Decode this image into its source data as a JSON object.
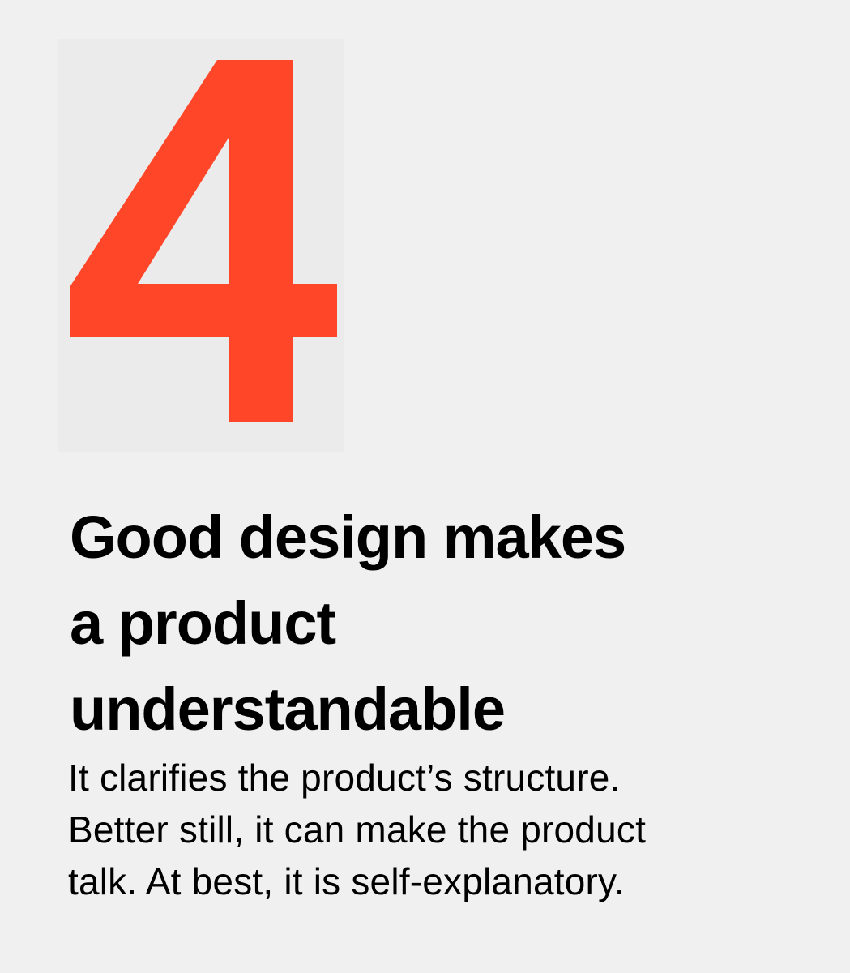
{
  "numeral": {
    "text": "4",
    "color": "#ff4628",
    "background": "#ebebeb"
  },
  "page": {
    "background": "#f0f0f0",
    "text_color": "#000000"
  },
  "headline": {
    "lines": [
      "Good design makes",
      "a product",
      "understandable"
    ]
  },
  "body": {
    "lines": [
      "It clarifies the product’s structure.",
      "Better still, it can make the product",
      "talk. At best, it is self-explanatory."
    ]
  }
}
